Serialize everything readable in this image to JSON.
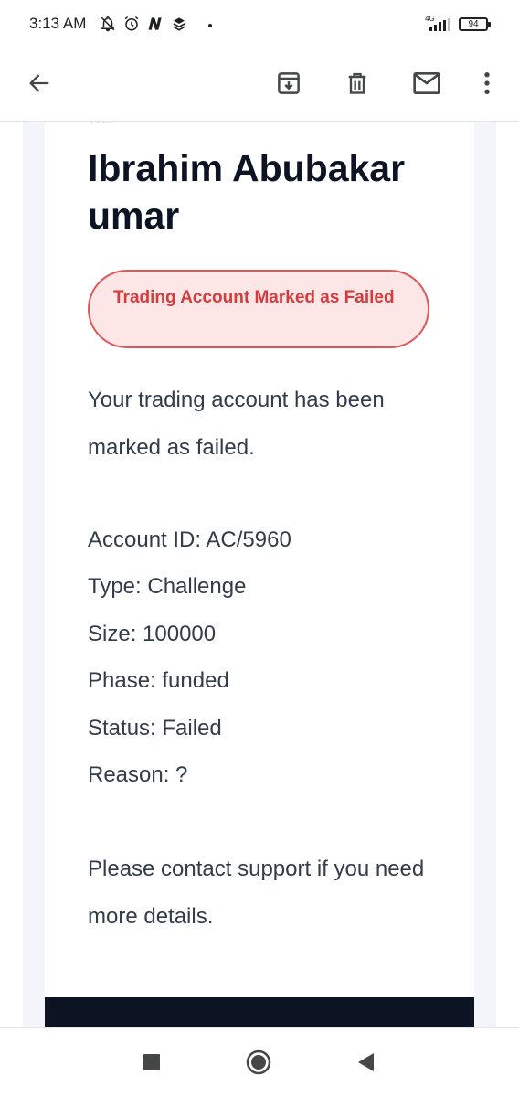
{
  "status_bar": {
    "time": "3:13 AM",
    "network": "4G",
    "battery": "94",
    "icons": [
      "bell-off-icon",
      "alarm-icon",
      "n-app-icon",
      "layers-icon",
      "signal-icon",
      "battery-icon"
    ]
  },
  "toolbar": {
    "icons": [
      "back-arrow-icon",
      "archive-icon",
      "delete-icon",
      "mail-icon",
      "more-vert-icon"
    ]
  },
  "email": {
    "recipient_name": "Ibrahim Abubakar umar",
    "badge_text": "Trading Account Marked as Failed",
    "intro": "Your trading account has been marked as failed.",
    "details": [
      "Account ID: AC/5960",
      "Type: Challenge",
      "Size: 100000",
      "Phase: funded",
      "Status: Failed",
      "Reason: ?"
    ],
    "closing": "Please contact support if you need more details."
  },
  "colors": {
    "heading": "#0c1424",
    "badge_border": "#e0575b",
    "badge_bg": "#fde6e6",
    "badge_text": "#d63b3e",
    "body_text": "#333c4b",
    "footer": "#0c1424"
  },
  "nav_bar": {
    "icons": [
      "recents-square-icon",
      "home-circle-icon",
      "back-triangle-icon"
    ]
  }
}
